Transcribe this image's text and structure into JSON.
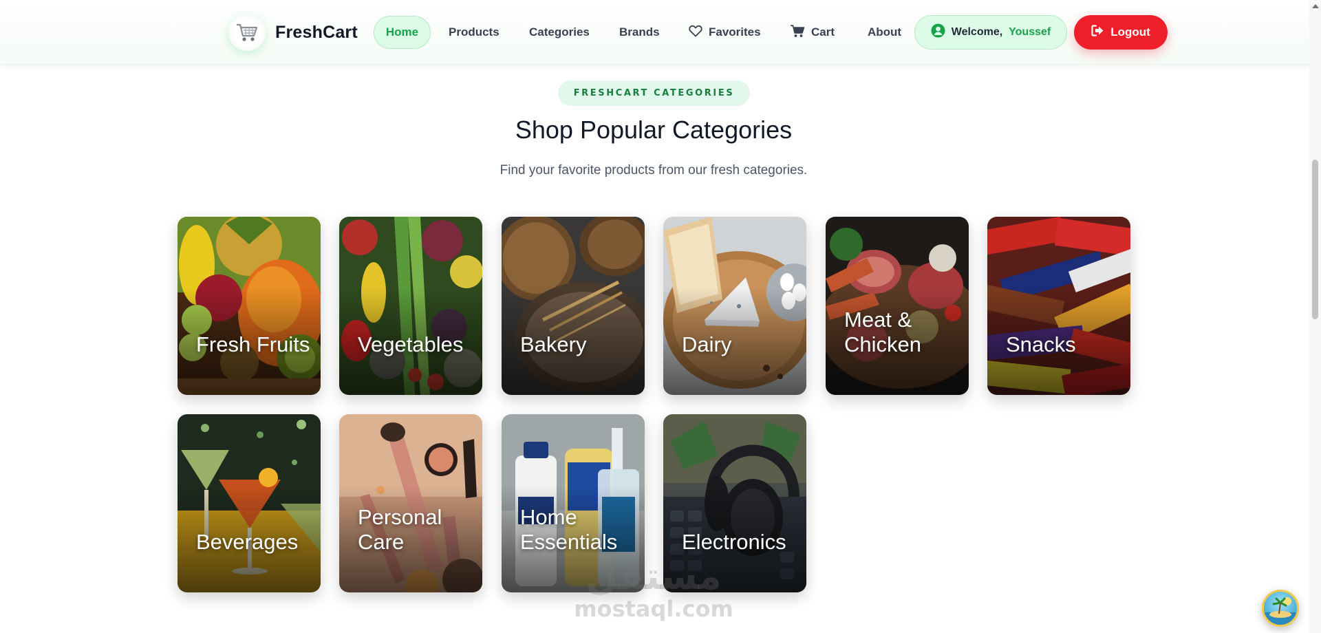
{
  "navbar": {
    "brand_name": "FreshCart",
    "links": {
      "home": "Home",
      "products": "Products",
      "categories": "Categories",
      "brands": "Brands",
      "favorites": "Favorites",
      "cart": "Cart",
      "about": "About"
    },
    "active_link": "Home",
    "welcome_prefix": "Welcome,",
    "user_name": "Youssef",
    "logout_label": "Logout"
  },
  "section": {
    "badge": "FRESHCART CATEGORIES",
    "title": "Shop Popular Categories",
    "subtitle": "Find your favorite products from our fresh categories."
  },
  "categories": [
    {
      "label": "Fresh Fruits"
    },
    {
      "label": "Vegetables"
    },
    {
      "label": "Bakery"
    },
    {
      "label": "Dairy"
    },
    {
      "label": "Meat & Chicken"
    },
    {
      "label": "Snacks"
    },
    {
      "label": "Beverages"
    },
    {
      "label": "Personal Care"
    },
    {
      "label": "Home Essentials"
    },
    {
      "label": "Electronics"
    }
  ],
  "watermark": {
    "arabic": "مستقل",
    "latin": "mostaql.com"
  },
  "colors": {
    "accent_green": "#16a34a",
    "logout_red": "#ef1f2a",
    "pill_green_bg": "#dcfce7"
  }
}
